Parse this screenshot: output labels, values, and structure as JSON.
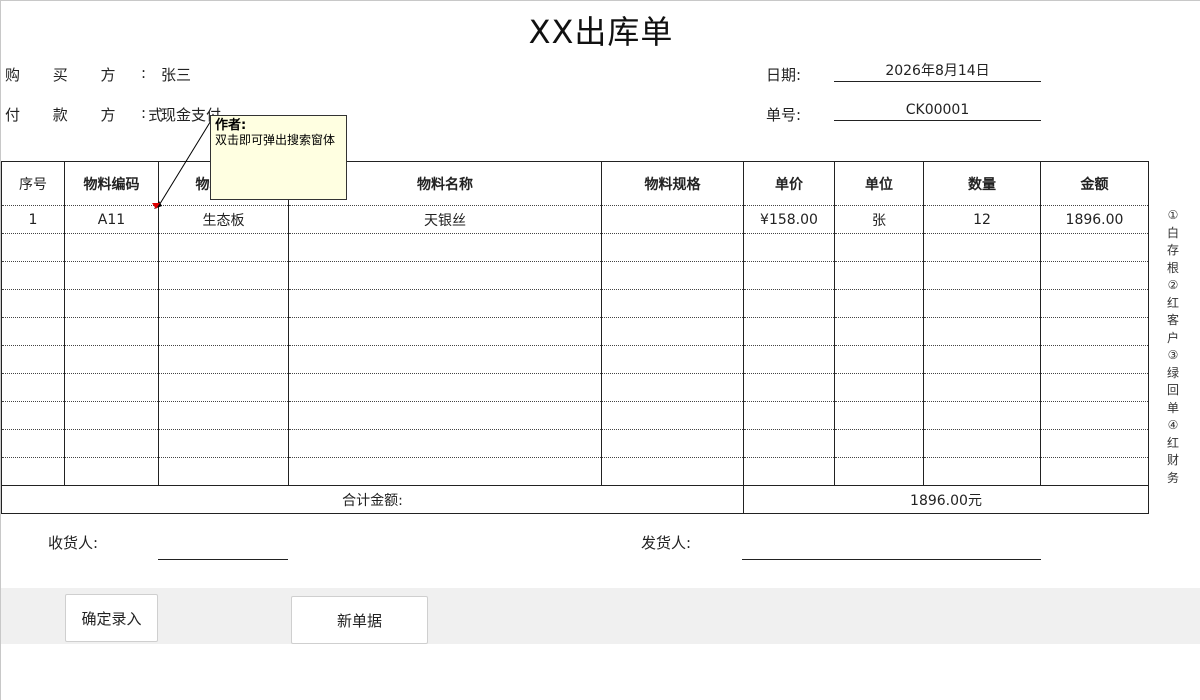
{
  "doc": {
    "title": "XX出库单"
  },
  "header": {
    "buyer_label": "购 买 方",
    "buyer_value": "张三",
    "payment_label": "付 款 方 式",
    "payment_value": "现金支付",
    "date_label": "日期:",
    "date_value": "2026年8月14日",
    "number_label": "单号:",
    "number_value": "CK00001",
    "colon": ":"
  },
  "comment": {
    "author": "作者:",
    "text": "双击即可弹出搜索窗体"
  },
  "table": {
    "headers": [
      "序号",
      "物料编码",
      "物料类别",
      "物料名称",
      "物料规格",
      "单价",
      "单位",
      "数量",
      "金额"
    ],
    "rows": [
      [
        "1",
        "A11",
        "生态板",
        "天银丝",
        "",
        "¥158.00",
        "张",
        "12",
        "1896.00"
      ],
      [
        "",
        "",
        "",
        "",
        "",
        "",
        "",
        "",
        ""
      ],
      [
        "",
        "",
        "",
        "",
        "",
        "",
        "",
        "",
        ""
      ],
      [
        "",
        "",
        "",
        "",
        "",
        "",
        "",
        "",
        ""
      ],
      [
        "",
        "",
        "",
        "",
        "",
        "",
        "",
        "",
        ""
      ],
      [
        "",
        "",
        "",
        "",
        "",
        "",
        "",
        "",
        ""
      ],
      [
        "",
        "",
        "",
        "",
        "",
        "",
        "",
        "",
        ""
      ],
      [
        "",
        "",
        "",
        "",
        "",
        "",
        "",
        "",
        ""
      ],
      [
        "",
        "",
        "",
        "",
        "",
        "",
        "",
        "",
        ""
      ],
      [
        "",
        "",
        "",
        "",
        "",
        "",
        "",
        "",
        ""
      ]
    ],
    "total_label": "合计金额:",
    "total_value": "1896.00元"
  },
  "side_note": [
    "①",
    "白",
    "存",
    "根",
    "②",
    "红",
    "客",
    "户",
    "③",
    "绿",
    "回",
    "单",
    "④",
    "红",
    "财",
    "务"
  ],
  "signatures": {
    "receiver_label": "收货人:",
    "shipper_label": "发货人:"
  },
  "buttons": {
    "confirm_label": "确定录入",
    "new_label": "新单据"
  }
}
